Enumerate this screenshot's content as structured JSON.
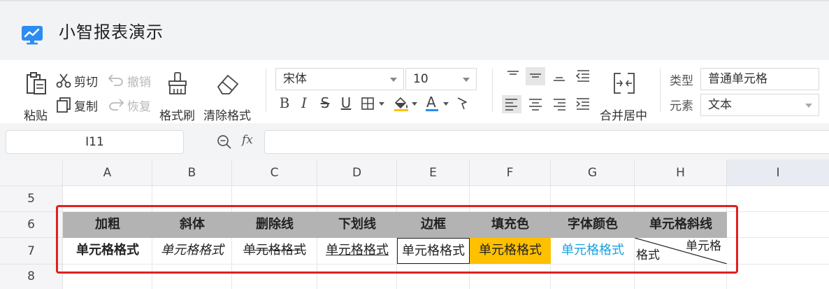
{
  "app": {
    "title": "小智报表演示"
  },
  "ribbon": {
    "paste": "粘贴",
    "cut": "剪切",
    "copy": "复制",
    "undo": "撤销",
    "redo": "恢复",
    "format_painter": "格式刷",
    "clear_format": "清除格式",
    "font_family": "宋体",
    "font_size": "10",
    "bold": "B",
    "italic": "I",
    "strike": "S",
    "underline": "U",
    "font_color_glyph": "A",
    "merge_center": "合并居中",
    "type_label": "类型",
    "type_value": "普通单元格",
    "element_label": "元素",
    "element_value": "文本"
  },
  "formula": {
    "cell_ref": "I11",
    "fx": "fx",
    "value": ""
  },
  "grid": {
    "columns": [
      "A",
      "B",
      "C",
      "D",
      "E",
      "F",
      "G",
      "H",
      "I"
    ],
    "rows": [
      "5",
      "6",
      "7",
      "8"
    ],
    "header_row": [
      "加粗",
      "斜体",
      "删除线",
      "下划线",
      "边框",
      "填充色",
      "字体颜色",
      "单元格斜线"
    ],
    "sample_row": [
      "单元格格式",
      "单元格格式",
      "单元格格式",
      "单元格格式",
      "单元格格式",
      "单元格格式",
      "单元格格式"
    ],
    "diagonal_top": "单元格",
    "diagonal_bottom": "格式"
  },
  "colors": {
    "accent": "#2d8cf0",
    "header_fill": "#b3b3b3",
    "fill_color": "#ffc000",
    "font_color": "#1ba1e2",
    "selection": "#e02020"
  },
  "icons": {
    "app": "monitor-chart-icon",
    "paste": "clipboard-icon",
    "cut": "scissors-icon",
    "copy": "copy-icon",
    "undo": "undo-icon",
    "redo": "redo-icon",
    "format_painter": "brush-icon",
    "clear_format": "eraser-icon"
  }
}
